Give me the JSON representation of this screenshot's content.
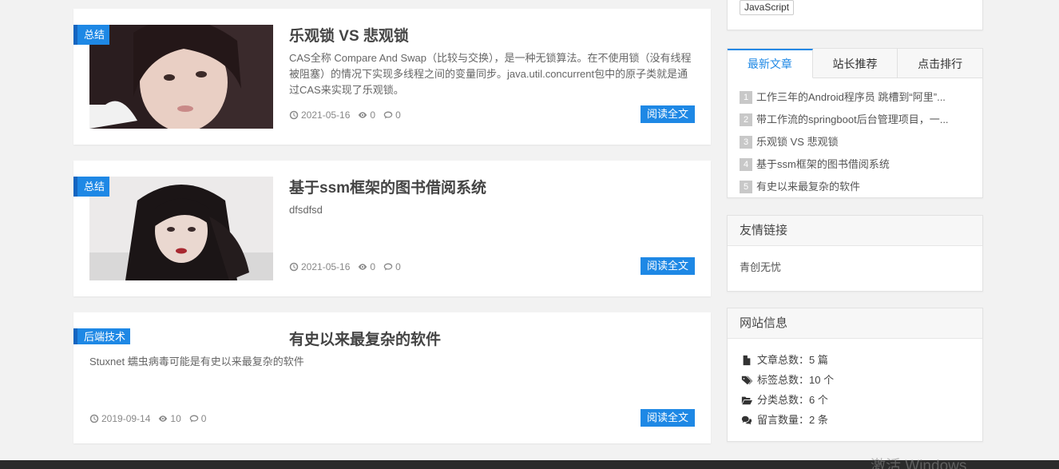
{
  "articles": [
    {
      "tag": "总结",
      "title": "乐观锁 VS 悲观锁",
      "excerpt": "CAS全称 Compare And Swap（比较与交换），是一种无锁算法。在不使用锁（没有线程被阻塞）的情况下实现多线程之间的变量同步。java.util.concurrent包中的原子类就是通过CAS来实现了乐观锁。",
      "date": "2021-05-16",
      "views": "0",
      "comments": "0",
      "read_label": "阅读全文",
      "thumb_colors": [
        "#2a1d1f",
        "#e9cfc4"
      ]
    },
    {
      "tag": "总结",
      "title": "基于ssm框架的图书借阅系统",
      "excerpt": "dfsdfsd",
      "date": "2021-05-16",
      "views": "0",
      "comments": "0",
      "read_label": "阅读全文",
      "thumb_colors": [
        "#eceaea",
        "#1b1516"
      ]
    },
    {
      "tag": "后端技术",
      "title": "有史以来最复杂的软件",
      "excerpt": "Stuxnet 蠕虫病毒可能是有史以来最复杂的软件",
      "date": "2019-09-14",
      "views": "10",
      "comments": "0",
      "read_label": "阅读全文"
    }
  ],
  "sidebar": {
    "tag_cloud": {
      "tag": "JavaScript"
    },
    "tabs": [
      {
        "label": "最新文章"
      },
      {
        "label": "站长推荐"
      },
      {
        "label": "点击排行"
      }
    ],
    "recent": [
      {
        "num": "1",
        "text": "工作三年的Android程序员 跳槽到“阿里”..."
      },
      {
        "num": "2",
        "text": "带工作流的springboot后台管理项目，一..."
      },
      {
        "num": "3",
        "text": "乐观锁 VS 悲观锁"
      },
      {
        "num": "4",
        "text": "基于ssm框架的图书借阅系统"
      },
      {
        "num": "5",
        "text": "有史以来最复杂的软件"
      }
    ],
    "links": {
      "title": "友情链接",
      "items": [
        "青创无忧"
      ]
    },
    "info": {
      "title": "网站信息",
      "items": [
        {
          "icon": "file-icon",
          "text": "文章总数：5 篇"
        },
        {
          "icon": "tags-icon",
          "text": "标签总数：10 个"
        },
        {
          "icon": "folder-open-icon",
          "text": "分类总数：6 个"
        },
        {
          "icon": "comments-icon",
          "text": "留言数量：2 条"
        }
      ]
    }
  },
  "watermark": "激活 Windows",
  "accent_color": "#1e88e5"
}
